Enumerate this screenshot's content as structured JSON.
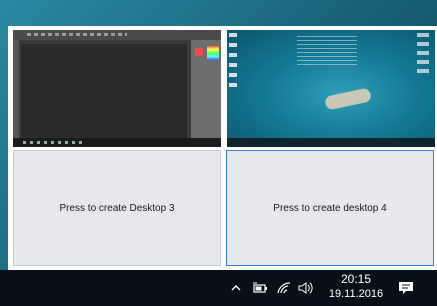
{
  "task_view": {
    "desktop3_label": "Press to create Desktop 3",
    "desktop4_label": "Press to create desktop 4"
  },
  "taskbar": {
    "time": "20:15",
    "date": "19.11.2016"
  },
  "icons": {
    "tray_chevron": "chevron-up-icon",
    "battery": "battery-icon",
    "wifi": "wifi-icon",
    "volume": "volume-icon",
    "notifications": "notification-icon"
  },
  "colors": {
    "taskbar_bg": "#071018",
    "tile_bg": "#e6e8eb",
    "selected_border": "#3b7fd0"
  }
}
